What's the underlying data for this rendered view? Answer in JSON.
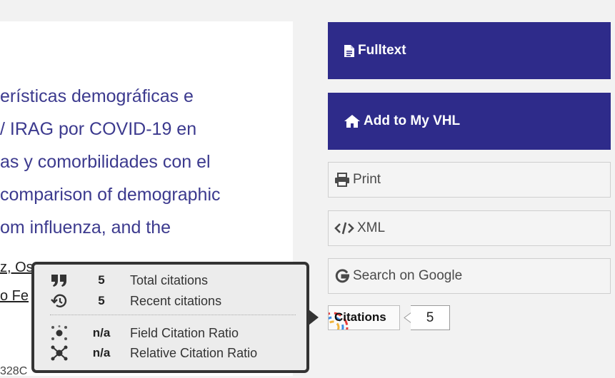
{
  "article": {
    "title_lines": [
      "erísticas demográficas e",
      "/ IRAG por COVID-19 en",
      "as y comorbilidades con el",
      "comparison of demographic",
      "om influenza, and the"
    ],
    "author_1": "z, Os",
    "author_2": "o Fe",
    "tail_text": "328C"
  },
  "actions": {
    "fulltext": "Fulltext",
    "add_vhl": "Add to My VHL",
    "print": "Print",
    "xml": "XML",
    "google": "Search on Google"
  },
  "citations": {
    "badge_label": "Citations",
    "count": "5",
    "popup": {
      "total_value": "5",
      "total_label": "Total citations",
      "recent_value": "5",
      "recent_label": "Recent citations",
      "fcr_value": "n/a",
      "fcr_label": "Field Citation Ratio",
      "rcr_value": "n/a",
      "rcr_label": "Relative Citation Ratio"
    }
  },
  "colors": {
    "primary_button": "#2e2b8a",
    "title_text": "#3c3a8e",
    "popup_border": "#333333"
  }
}
